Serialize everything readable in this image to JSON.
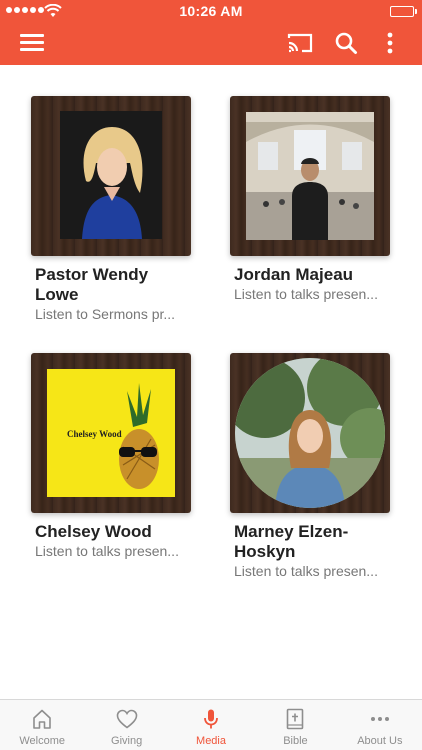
{
  "status_bar": {
    "time": "10:26 AM"
  },
  "colors": {
    "accent": "#f0553a",
    "inactive": "#8e8e8e"
  },
  "header": {
    "icons": [
      "hamburger-menu-icon",
      "cast-icon",
      "search-icon",
      "more-vertical-icon"
    ]
  },
  "cards": [
    {
      "title": "Pastor Wendy Lowe",
      "subtitle": "Listen to Sermons pr..."
    },
    {
      "title": "Jordan Majeau",
      "subtitle": "Listen to talks presen..."
    },
    {
      "title": "Chelsey Wood",
      "subtitle": "Listen to talks presen...",
      "image_text": "Chelsey Wood"
    },
    {
      "title": "Marney Elzen-Hoskyn",
      "subtitle": "Listen to talks presen..."
    }
  ],
  "tabs": [
    {
      "label": "Welcome",
      "icon": "home-icon",
      "active": false
    },
    {
      "label": "Giving",
      "icon": "heart-icon",
      "active": false
    },
    {
      "label": "Media",
      "icon": "microphone-icon",
      "active": true
    },
    {
      "label": "Bible",
      "icon": "bible-icon",
      "active": false
    },
    {
      "label": "About Us",
      "icon": "ellipsis-icon",
      "active": false
    }
  ]
}
